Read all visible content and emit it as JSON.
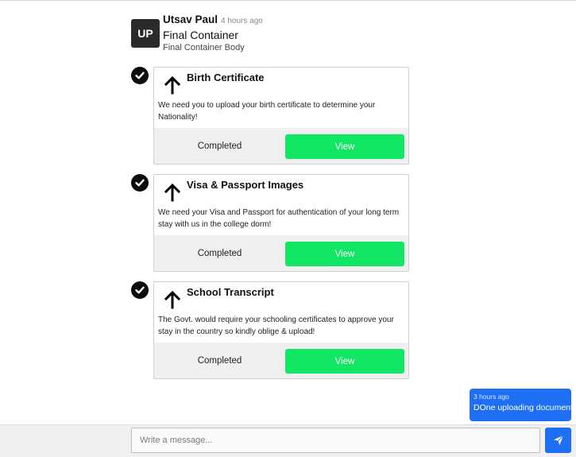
{
  "message": {
    "avatar_initials": "UP",
    "sender": "Utsav Paul",
    "time": "4 hours ago",
    "title": "Final Container",
    "body": "Final Container Body"
  },
  "tasks": [
    {
      "title": "Birth Certificate",
      "description": "We need you to upload your birth certificate to determine your Nationality!",
      "status": "Completed",
      "action": "View"
    },
    {
      "title": "Visa & Passport Images",
      "description": "We need your Visa and Passport for authentication of your long term stay with us in the college dorm!",
      "status": "Completed",
      "action": "View"
    },
    {
      "title": "School Transcript",
      "description": "The Govt. would require your schooling certificates to approve your stay in the country so kindly oblige & upload!",
      "status": "Completed",
      "action": "View"
    }
  ],
  "outgoing": {
    "time": "3 hours ago",
    "text": "DOne uploading document"
  },
  "composer": {
    "placeholder": "Write a message..."
  },
  "icons": {
    "check": "check-circle-icon",
    "upload": "upload-arrow-icon",
    "send": "send-icon"
  },
  "colors": {
    "view_button": "#12e665",
    "send_button": "#1f6ff5",
    "bubble": "#1f6ff5",
    "avatar": "#2b2b2b"
  }
}
